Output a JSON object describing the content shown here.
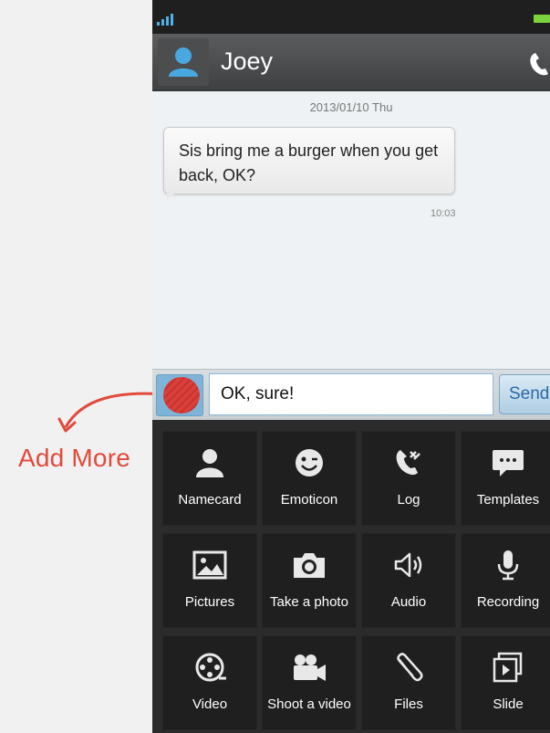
{
  "annotation": {
    "label": "Add More",
    "color": "#e14a3c"
  },
  "status_bar": {
    "signal_icon": "signal-bars-icon",
    "battery_icon": "battery-icon"
  },
  "header": {
    "contact_name": "Joey",
    "avatar_icon": "person-icon",
    "call_icon": "phone-icon"
  },
  "chat": {
    "date": "2013/01/10 Thu",
    "messages": [
      {
        "text": "Sis bring me a burger when you get back, OK?",
        "time": "10:03"
      }
    ]
  },
  "composer": {
    "value": "OK, sure!",
    "send_label": "Send",
    "add_icon": "add-more-icon"
  },
  "attachments": [
    {
      "label": "Namecard",
      "icon": "person-icon"
    },
    {
      "label": "Emoticon",
      "icon": "smiley-icon"
    },
    {
      "label": "Log",
      "icon": "call-log-icon"
    },
    {
      "label": "Templates",
      "icon": "speech-bubble-icon"
    },
    {
      "label": "Pictures",
      "icon": "picture-icon"
    },
    {
      "label": "Take a photo",
      "icon": "camera-icon"
    },
    {
      "label": "Audio",
      "icon": "speaker-icon"
    },
    {
      "label": "Recording",
      "icon": "microphone-icon"
    },
    {
      "label": "Video",
      "icon": "film-reel-icon"
    },
    {
      "label": "Shoot a video",
      "icon": "video-camera-icon"
    },
    {
      "label": "Files",
      "icon": "paperclip-icon"
    },
    {
      "label": "Slide",
      "icon": "slideshow-icon"
    }
  ]
}
